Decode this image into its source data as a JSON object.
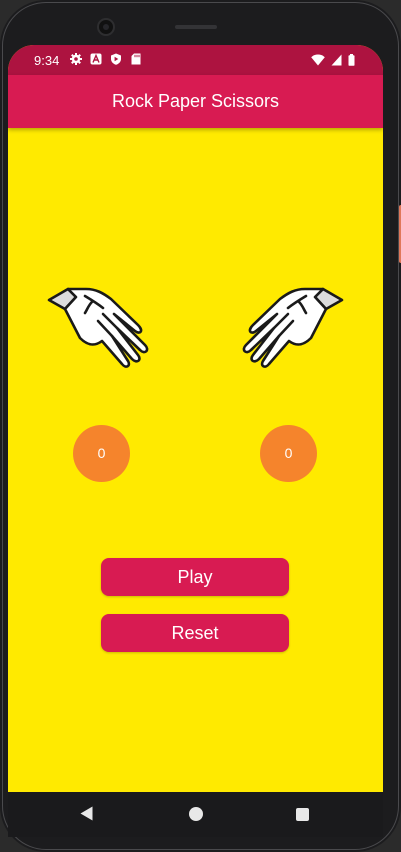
{
  "status_bar": {
    "time": "9:34",
    "left_icons": [
      "settings-gear-icon",
      "a-box-icon",
      "play-shield-icon",
      "sd-card-icon"
    ],
    "right_icons": [
      "wifi-icon",
      "cell-signal-icon",
      "battery-icon"
    ]
  },
  "app_bar": {
    "title": "Rock Paper Scissors"
  },
  "game": {
    "left_hand_icon": "open-hand-paper-icon",
    "right_hand_icon": "open-hand-paper-icon",
    "left_score": "0",
    "right_score": "0"
  },
  "buttons": {
    "play_label": "Play",
    "reset_label": "Reset"
  },
  "nav_bar": {
    "icons": [
      "back-icon",
      "home-icon",
      "recents-icon"
    ]
  },
  "colors": {
    "background": "#ffea00",
    "app_bar": "#d81b52",
    "status_bar": "#ad1340",
    "score_circle": "#f5842c",
    "button": "#d81b52"
  }
}
